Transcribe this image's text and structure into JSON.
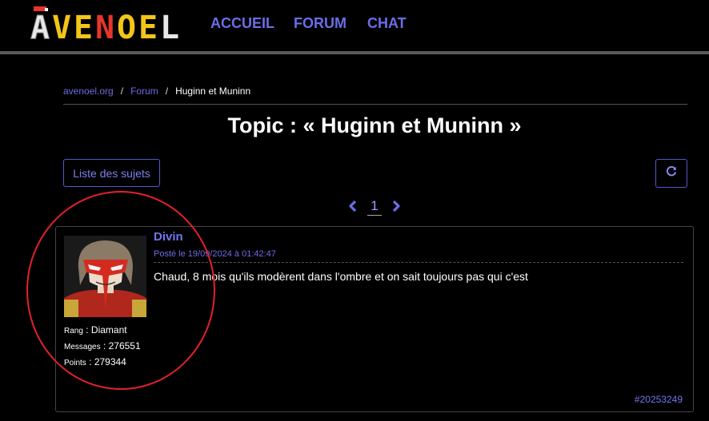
{
  "site": {
    "logo_text": "AVENOEL",
    "nav": [
      {
        "label": "ACCUEIL"
      },
      {
        "label": "FORUM"
      },
      {
        "label": "CHAT"
      }
    ]
  },
  "breadcrumb": {
    "home": "avenoel.org",
    "forum": "Forum",
    "current": "Huginn et Muninn"
  },
  "page_title": "Topic : « Huginn et Muninn »",
  "topic_list_button": "Liste des sujets",
  "refresh_icon": "refresh-icon",
  "pagination": {
    "current_page": "1",
    "prev_icon": "chevron-left-icon",
    "next_icon": "chevron-right-icon"
  },
  "post": {
    "author": "Divin",
    "date": "Posté le 19/09/2024 à 01:42:47",
    "body": "Chaud, 8 mois qu'ils modèrent dans l'ombre et on sait toujours pas qui c'est",
    "id": "#20253249",
    "stats": {
      "rank_label": "Rang",
      "rank_value": "Diamant",
      "messages_label": "Messages",
      "messages_value": "276551",
      "points_label": "Points",
      "points_value": "279344"
    }
  },
  "colors": {
    "accent": "#6b6ee6",
    "background": "#000000",
    "annotation": "#e3212b"
  }
}
